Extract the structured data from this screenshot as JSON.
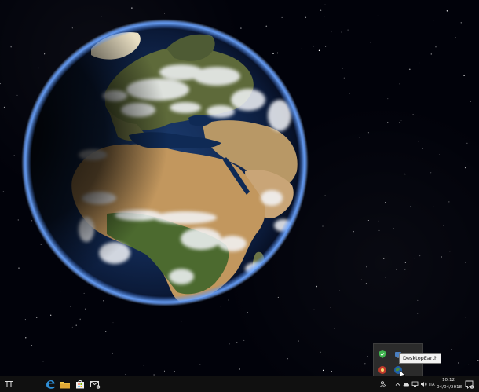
{
  "desktop": {
    "wallpaper": "DesktopEarth globe view of Europe and Africa",
    "space_color": "#01020a"
  },
  "tray_overflow": {
    "tooltip": "DesktopEarth"
  },
  "taskbar": {
    "background": "#101010",
    "clock": {
      "time": "10:12",
      "date": "04/04/2018"
    }
  }
}
